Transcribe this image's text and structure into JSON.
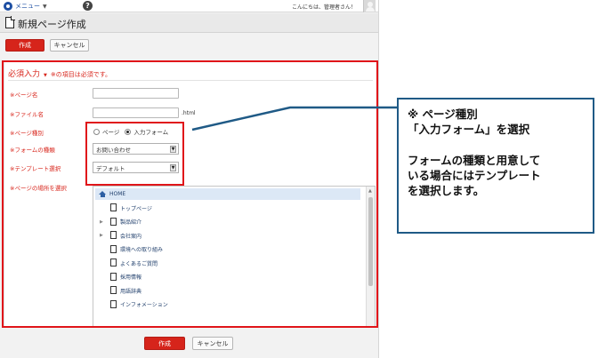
{
  "topbar": {
    "menu_label": "メニュー",
    "menu_caret": "▼",
    "help_label": "?",
    "greeting": "こんにちは、管理者さん！"
  },
  "header": {
    "title": "新規ページ作成"
  },
  "toolbar": {
    "create_label": "作成",
    "cancel_label": "キャンセル"
  },
  "form": {
    "required_title": "必須入力",
    "required_caret": "▼",
    "required_note": "※の項目は必須です。",
    "fields": {
      "page_name_label": "※ページ名",
      "file_name_label": "※ファイル名",
      "file_suffix": ".html",
      "page_type_label": "※ページ種別",
      "page_type_options": [
        "ページ",
        "入力フォーム"
      ],
      "page_type_selected": "入力フォーム",
      "form_type_label": "※フォームの種類",
      "form_type_value": "お問い合わせ",
      "template_label": "※テンプレート選択",
      "template_value": "デフォルト",
      "location_label": "※ページの場所を選択"
    },
    "tree": {
      "root": "HOME",
      "items": [
        {
          "label": "トップページ",
          "expandable": false
        },
        {
          "label": "製品紹介",
          "expandable": true
        },
        {
          "label": "会社案内",
          "expandable": true
        },
        {
          "label": "環境への取り組み",
          "expandable": false
        },
        {
          "label": "よくあるご質問",
          "expandable": false
        },
        {
          "label": "採用情報",
          "expandable": false
        },
        {
          "label": "用語辞典",
          "expandable": false
        },
        {
          "label": "インフォメーション",
          "expandable": false
        }
      ]
    }
  },
  "footer": {
    "create_label": "作成",
    "cancel_label": "キャンセル"
  },
  "callout": {
    "line1": "※ ページ種別",
    "line2": "「入力フォーム」を選択",
    "line3": "フォームの種類と用意して",
    "line4": "いる場合にはテンプレート",
    "line5": "を選択します。"
  },
  "colors": {
    "accent_red": "#d6241b",
    "highlight_red": "#e0151a",
    "callout_border": "#1f5a86",
    "link_blue": "#1e4fa3"
  }
}
